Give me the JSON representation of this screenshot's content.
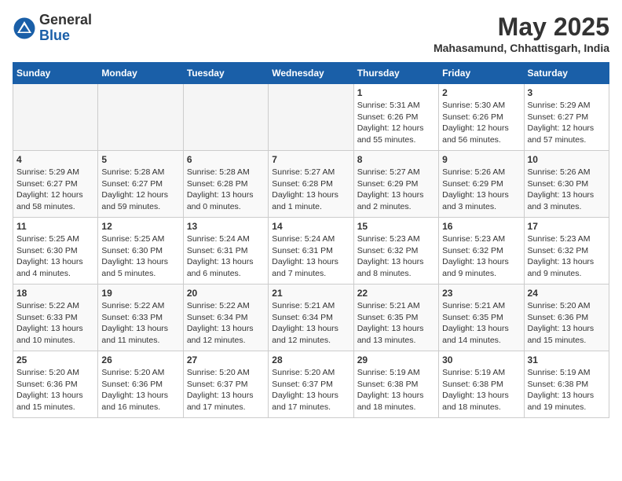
{
  "header": {
    "logo_general": "General",
    "logo_blue": "Blue",
    "title": "May 2025",
    "location": "Mahasamund, Chhattisgarh, India"
  },
  "weekdays": [
    "Sunday",
    "Monday",
    "Tuesday",
    "Wednesday",
    "Thursday",
    "Friday",
    "Saturday"
  ],
  "weeks": [
    [
      {
        "day": "",
        "info": ""
      },
      {
        "day": "",
        "info": ""
      },
      {
        "day": "",
        "info": ""
      },
      {
        "day": "",
        "info": ""
      },
      {
        "day": "1",
        "info": "Sunrise: 5:31 AM\nSunset: 6:26 PM\nDaylight: 12 hours\nand 55 minutes."
      },
      {
        "day": "2",
        "info": "Sunrise: 5:30 AM\nSunset: 6:26 PM\nDaylight: 12 hours\nand 56 minutes."
      },
      {
        "day": "3",
        "info": "Sunrise: 5:29 AM\nSunset: 6:27 PM\nDaylight: 12 hours\nand 57 minutes."
      }
    ],
    [
      {
        "day": "4",
        "info": "Sunrise: 5:29 AM\nSunset: 6:27 PM\nDaylight: 12 hours\nand 58 minutes."
      },
      {
        "day": "5",
        "info": "Sunrise: 5:28 AM\nSunset: 6:27 PM\nDaylight: 12 hours\nand 59 minutes."
      },
      {
        "day": "6",
        "info": "Sunrise: 5:28 AM\nSunset: 6:28 PM\nDaylight: 13 hours\nand 0 minutes."
      },
      {
        "day": "7",
        "info": "Sunrise: 5:27 AM\nSunset: 6:28 PM\nDaylight: 13 hours\nand 1 minute."
      },
      {
        "day": "8",
        "info": "Sunrise: 5:27 AM\nSunset: 6:29 PM\nDaylight: 13 hours\nand 2 minutes."
      },
      {
        "day": "9",
        "info": "Sunrise: 5:26 AM\nSunset: 6:29 PM\nDaylight: 13 hours\nand 3 minutes."
      },
      {
        "day": "10",
        "info": "Sunrise: 5:26 AM\nSunset: 6:30 PM\nDaylight: 13 hours\nand 3 minutes."
      }
    ],
    [
      {
        "day": "11",
        "info": "Sunrise: 5:25 AM\nSunset: 6:30 PM\nDaylight: 13 hours\nand 4 minutes."
      },
      {
        "day": "12",
        "info": "Sunrise: 5:25 AM\nSunset: 6:30 PM\nDaylight: 13 hours\nand 5 minutes."
      },
      {
        "day": "13",
        "info": "Sunrise: 5:24 AM\nSunset: 6:31 PM\nDaylight: 13 hours\nand 6 minutes."
      },
      {
        "day": "14",
        "info": "Sunrise: 5:24 AM\nSunset: 6:31 PM\nDaylight: 13 hours\nand 7 minutes."
      },
      {
        "day": "15",
        "info": "Sunrise: 5:23 AM\nSunset: 6:32 PM\nDaylight: 13 hours\nand 8 minutes."
      },
      {
        "day": "16",
        "info": "Sunrise: 5:23 AM\nSunset: 6:32 PM\nDaylight: 13 hours\nand 9 minutes."
      },
      {
        "day": "17",
        "info": "Sunrise: 5:23 AM\nSunset: 6:32 PM\nDaylight: 13 hours\nand 9 minutes."
      }
    ],
    [
      {
        "day": "18",
        "info": "Sunrise: 5:22 AM\nSunset: 6:33 PM\nDaylight: 13 hours\nand 10 minutes."
      },
      {
        "day": "19",
        "info": "Sunrise: 5:22 AM\nSunset: 6:33 PM\nDaylight: 13 hours\nand 11 minutes."
      },
      {
        "day": "20",
        "info": "Sunrise: 5:22 AM\nSunset: 6:34 PM\nDaylight: 13 hours\nand 12 minutes."
      },
      {
        "day": "21",
        "info": "Sunrise: 5:21 AM\nSunset: 6:34 PM\nDaylight: 13 hours\nand 12 minutes."
      },
      {
        "day": "22",
        "info": "Sunrise: 5:21 AM\nSunset: 6:35 PM\nDaylight: 13 hours\nand 13 minutes."
      },
      {
        "day": "23",
        "info": "Sunrise: 5:21 AM\nSunset: 6:35 PM\nDaylight: 13 hours\nand 14 minutes."
      },
      {
        "day": "24",
        "info": "Sunrise: 5:20 AM\nSunset: 6:36 PM\nDaylight: 13 hours\nand 15 minutes."
      }
    ],
    [
      {
        "day": "25",
        "info": "Sunrise: 5:20 AM\nSunset: 6:36 PM\nDaylight: 13 hours\nand 15 minutes."
      },
      {
        "day": "26",
        "info": "Sunrise: 5:20 AM\nSunset: 6:36 PM\nDaylight: 13 hours\nand 16 minutes."
      },
      {
        "day": "27",
        "info": "Sunrise: 5:20 AM\nSunset: 6:37 PM\nDaylight: 13 hours\nand 17 minutes."
      },
      {
        "day": "28",
        "info": "Sunrise: 5:20 AM\nSunset: 6:37 PM\nDaylight: 13 hours\nand 17 minutes."
      },
      {
        "day": "29",
        "info": "Sunrise: 5:19 AM\nSunset: 6:38 PM\nDaylight: 13 hours\nand 18 minutes."
      },
      {
        "day": "30",
        "info": "Sunrise: 5:19 AM\nSunset: 6:38 PM\nDaylight: 13 hours\nand 18 minutes."
      },
      {
        "day": "31",
        "info": "Sunrise: 5:19 AM\nSunset: 6:38 PM\nDaylight: 13 hours\nand 19 minutes."
      }
    ]
  ]
}
